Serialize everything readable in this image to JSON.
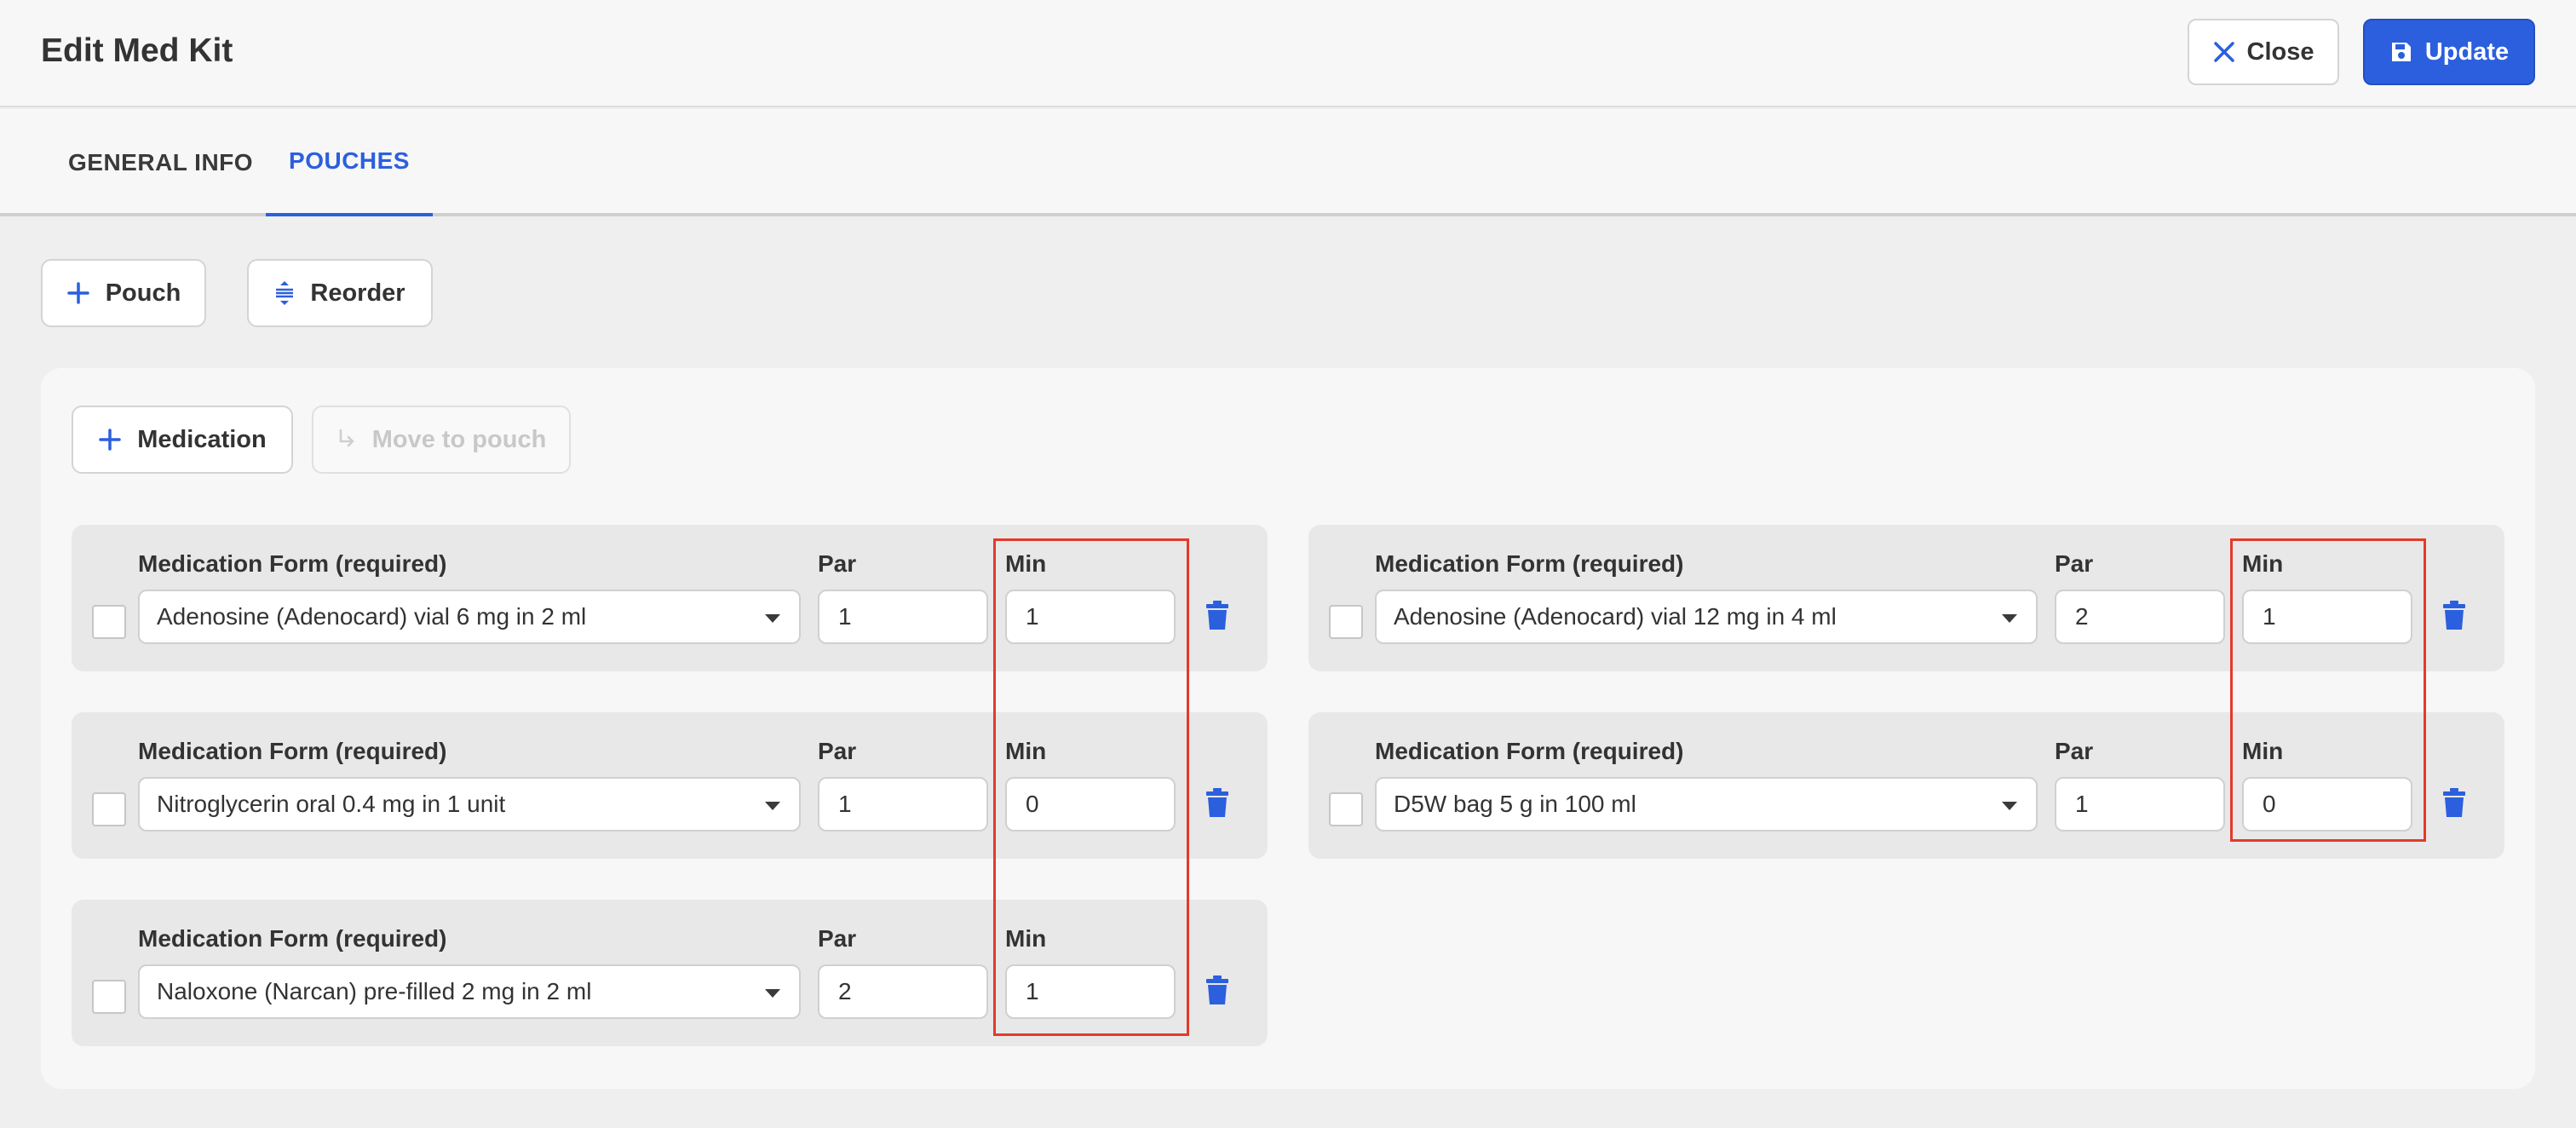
{
  "header": {
    "title": "Edit Med Kit",
    "close_label": "Close",
    "update_label": "Update"
  },
  "tabs": [
    {
      "label": "GENERAL INFO",
      "active": false
    },
    {
      "label": "POUCHES",
      "active": true
    }
  ],
  "toolbar": {
    "pouch_label": "Pouch",
    "reorder_label": "Reorder"
  },
  "pouch": {
    "medication_label": "Medication",
    "move_label": "Move to pouch",
    "field_labels": {
      "form": "Medication Form (required)",
      "par": "Par",
      "min": "Min"
    },
    "items": [
      {
        "form": "Adenosine (Adenocard) vial 6 mg in 2 ml",
        "par": "1",
        "min": "1"
      },
      {
        "form": "Adenosine (Adenocard) vial 12 mg in 4 ml",
        "par": "2",
        "min": "1"
      },
      {
        "form": "Nitroglycerin oral 0.4 mg in 1 unit",
        "par": "1",
        "min": "0"
      },
      {
        "form": "D5W bag 5 g in 100 ml",
        "par": "1",
        "min": "0"
      },
      {
        "form": "Naloxone (Narcan) pre-filled 2 mg in 2 ml",
        "par": "2",
        "min": "1"
      }
    ]
  },
  "colors": {
    "accent": "#2b5fde",
    "highlight": "#e53a2a"
  },
  "icons": [
    "close-icon",
    "save-icon",
    "plus-icon",
    "reorder-icon",
    "move-icon",
    "chevron-down-icon",
    "trash-icon"
  ]
}
